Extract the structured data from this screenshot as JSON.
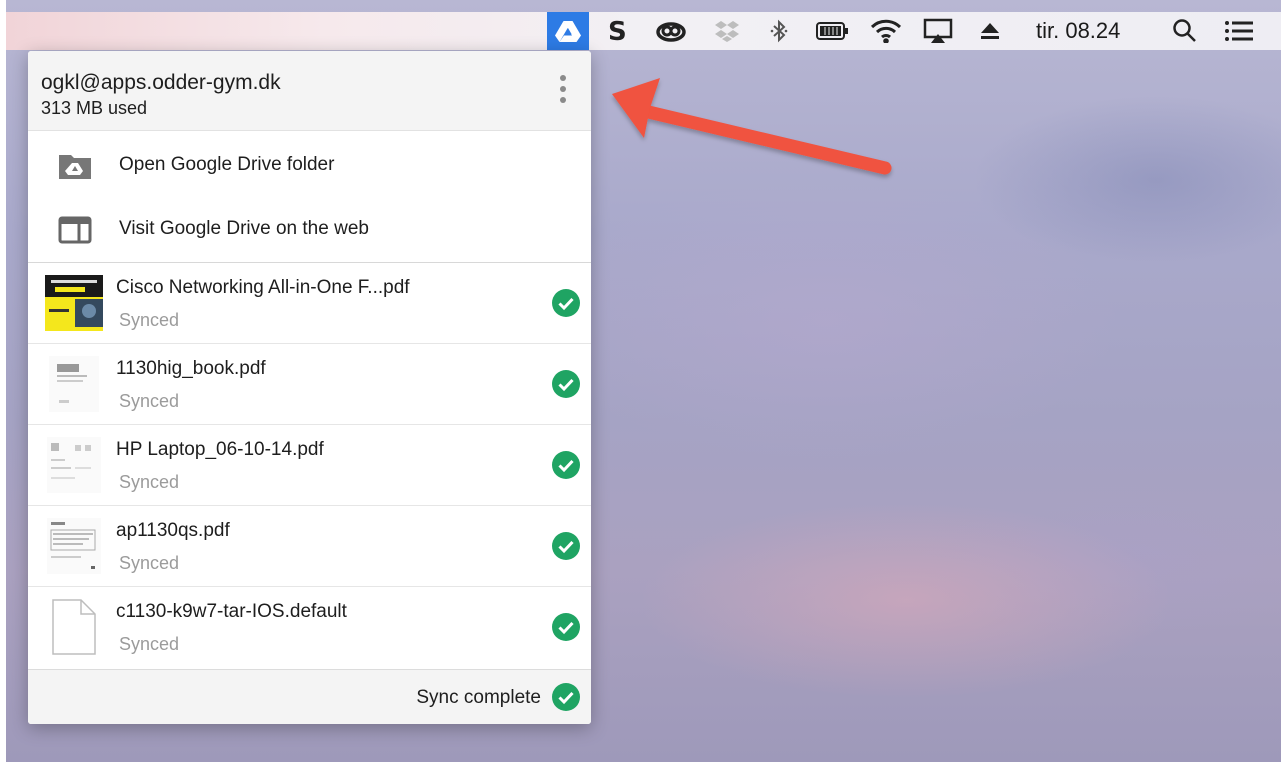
{
  "menubar": {
    "clock": "tir. 08.24",
    "icons": [
      "google-drive-icon",
      "skype-s-icon",
      "creative-cloud-icon",
      "dropbox-icon",
      "bluetooth-icon",
      "battery-icon",
      "wifi-icon",
      "airplay-icon",
      "eject-icon",
      "spotlight-search-icon",
      "notification-center-icon"
    ],
    "active_color": "#2d7be5"
  },
  "panel": {
    "account_email": "ogkl@apps.odder-gym.dk",
    "storage_used": "313 MB used",
    "actions": [
      {
        "label": "Open Google Drive folder",
        "icon": "drive-folder-icon"
      },
      {
        "label": "Visit Google Drive on the web",
        "icon": "browser-window-icon"
      }
    ],
    "files": [
      {
        "name": "Cisco Networking All-in-One F...pdf",
        "status": "Synced"
      },
      {
        "name": "1130hig_book.pdf",
        "status": "Synced"
      },
      {
        "name": "HP Laptop_06-10-14.pdf",
        "status": "Synced"
      },
      {
        "name": "ap1130qs.pdf",
        "status": "Synced"
      },
      {
        "name": "c1130-k9w7-tar-IOS.default",
        "status": "Synced"
      }
    ],
    "footer_status": "Sync complete",
    "check_color": "#1fa463"
  },
  "annotation": {
    "arrow_color": "#f0523f"
  }
}
